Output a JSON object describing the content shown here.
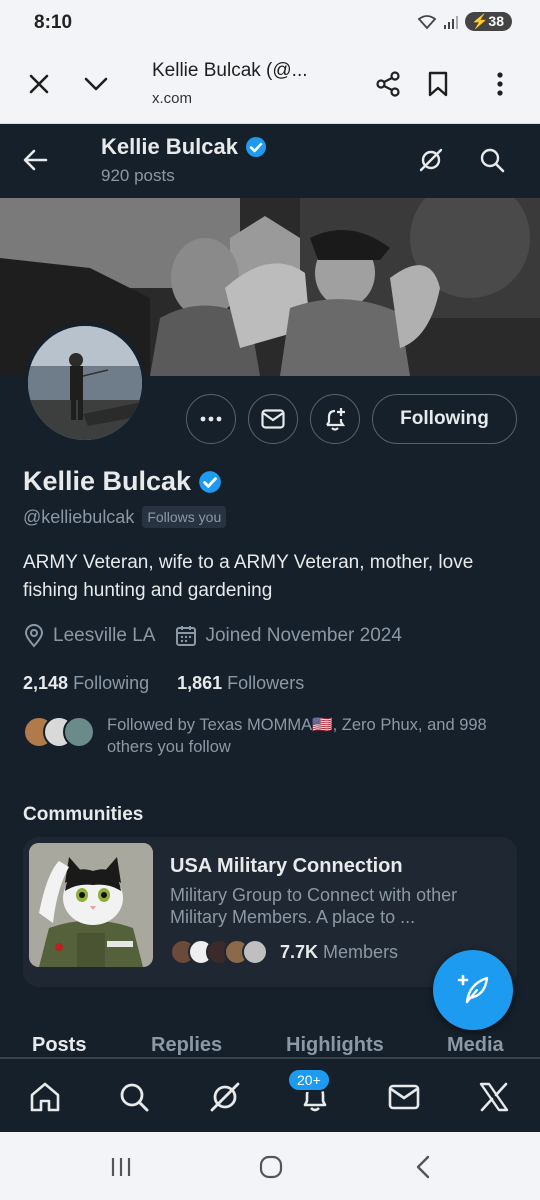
{
  "status": {
    "time": "8:10",
    "battery": "38"
  },
  "browser": {
    "title": "Kellie Bulcak (@...",
    "url": "x.com"
  },
  "header": {
    "name": "Kellie Bulcak",
    "posts": "920 posts"
  },
  "profile": {
    "name": "Kellie Bulcak",
    "handle": "@kelliebulcak",
    "follows_you": "Follows you",
    "bio": "ARMY Veteran, wife to a ARMY Veteran, mother, love fishing hunting and gardening",
    "location": "Leesville LA",
    "joined": "Joined November 2024",
    "following_count": "2,148",
    "following_label": "Following",
    "followers_count": "1,861",
    "followers_label": "Followers",
    "followed_by": "Followed by Texas MOMMA🇺🇸, Zero Phux, and 998 others you follow",
    "follow_button": "Following"
  },
  "communities": {
    "title": "Communities",
    "items": [
      {
        "name": "USA Military Connection",
        "description": "Military Group to Connect with other Military Members. A place to ...",
        "members_count": "7.7K",
        "members_label": "Members"
      }
    ]
  },
  "tabs": [
    "Posts",
    "Replies",
    "Highlights",
    "Media"
  ],
  "bottom_nav": {
    "notifications_badge": "20+"
  },
  "colors": {
    "background": "#15202b",
    "accent": "#1d9bf0",
    "muted": "#8b98a5"
  },
  "icons": [
    "close-icon",
    "chevron-down-icon",
    "share-icon",
    "bookmark-icon",
    "more-vert-icon",
    "back-arrow-icon",
    "grok-icon",
    "search-icon",
    "verified-icon",
    "more-icon",
    "message-icon",
    "notification-add-icon",
    "location-icon",
    "calendar-icon",
    "compose-icon",
    "home-icon",
    "bell-icon",
    "mail-icon",
    "x-logo-icon"
  ]
}
